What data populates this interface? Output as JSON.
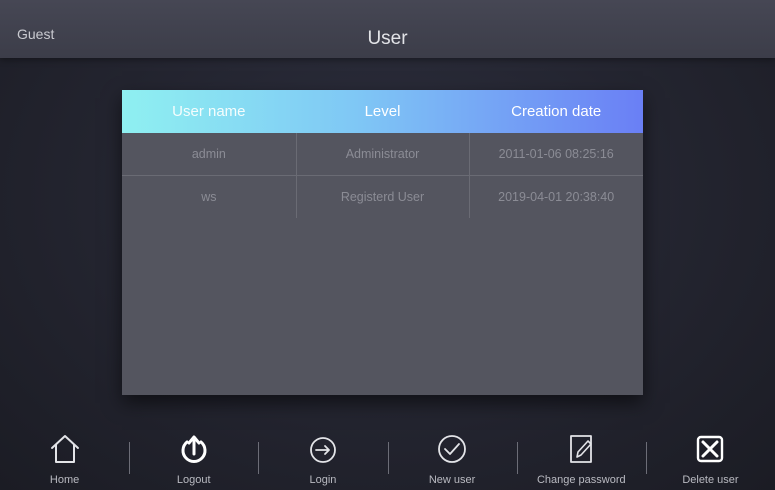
{
  "header": {
    "current_user": "Guest",
    "title": "User"
  },
  "table": {
    "columns": [
      "User name",
      "Level",
      "Creation date"
    ],
    "rows": [
      [
        "admin",
        "Administrator",
        "2011-01-06 08:25:16"
      ],
      [
        "ws",
        "Registerd User",
        "2019-04-01 20:38:40"
      ]
    ]
  },
  "toolbar": {
    "items": [
      {
        "label": "Home",
        "icon": "home-icon"
      },
      {
        "label": "Logout",
        "icon": "power-icon"
      },
      {
        "label": "Login",
        "icon": "arrow-right-circle-icon"
      },
      {
        "label": "New user",
        "icon": "check-circle-icon"
      },
      {
        "label": "Change password",
        "icon": "edit-document-icon"
      },
      {
        "label": "Delete user",
        "icon": "close-box-icon"
      }
    ]
  },
  "colors": {
    "header_gradient_start": "#8ff0f1",
    "header_gradient_end": "#6a7ff5",
    "panel": "#54555f",
    "background": "#23242f"
  }
}
